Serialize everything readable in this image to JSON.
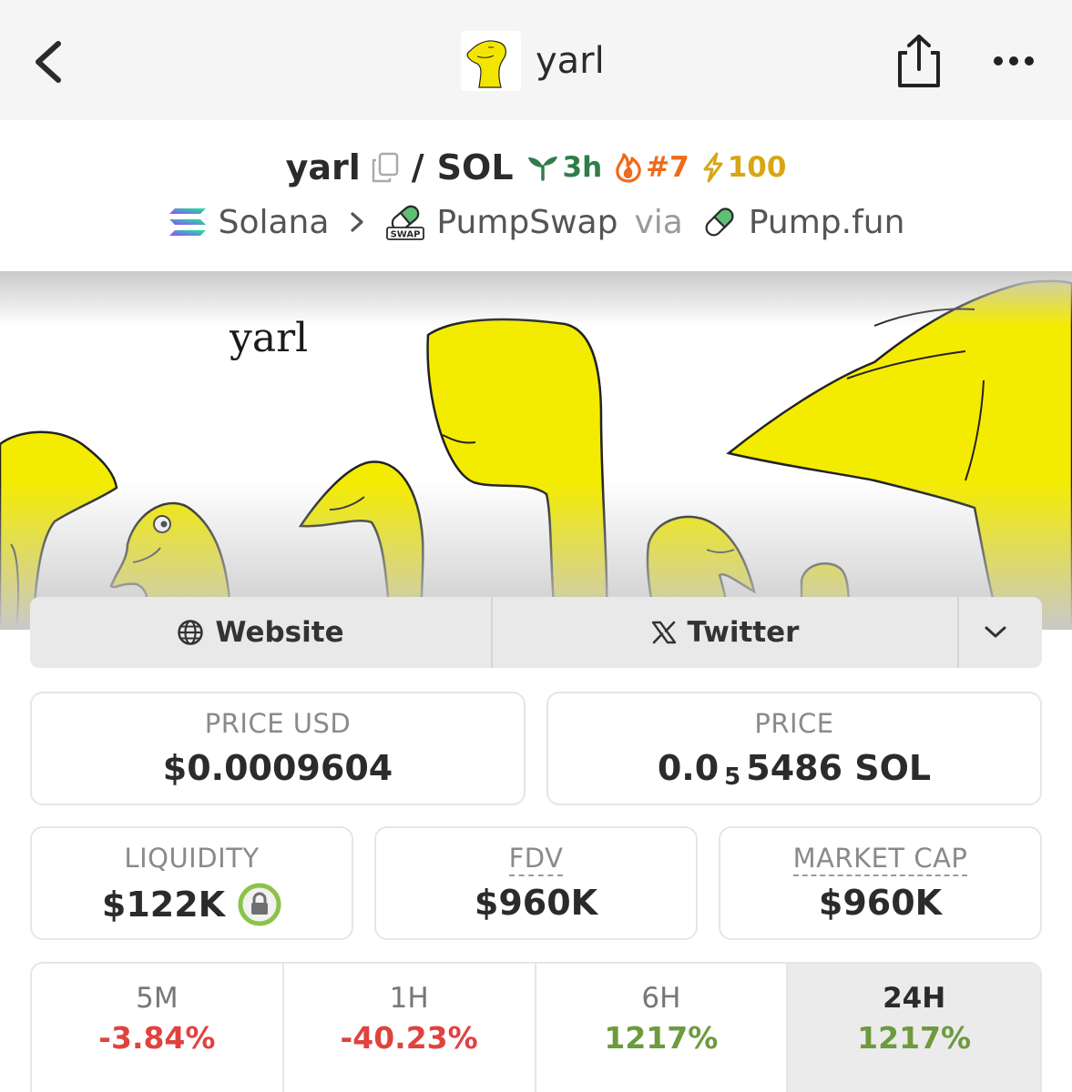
{
  "header": {
    "title": "yarl"
  },
  "pair": {
    "base": "yarl",
    "separator": "/",
    "quote": "SOL",
    "age": "3h",
    "rank": "#7",
    "boost": "100",
    "colors": {
      "age": "#2f7d4a",
      "rank": "#ef6a1a",
      "boost": "#d7a614"
    }
  },
  "chain": {
    "network": "Solana",
    "dex": "PumpSwap",
    "via_label": "via",
    "launchpad": "Pump.fun",
    "dex_icon_text": "SWAP"
  },
  "banner": {
    "caption": "yarl"
  },
  "links": {
    "website": "Website",
    "twitter": "Twitter"
  },
  "stats": {
    "price_usd_label": "PRICE USD",
    "price_usd": "$0.0009604",
    "price_label": "PRICE",
    "price_prefix": "0.0",
    "price_zeros": "5",
    "price_suffix": "5486 SOL",
    "liquidity_label": "LIQUIDITY",
    "liquidity": "$122K",
    "fdv_label": "FDV",
    "fdv": "$960K",
    "mcap_label": "MARKET CAP",
    "mcap": "$960K"
  },
  "changes": [
    {
      "label": "5M",
      "value": "-3.84%"
    },
    {
      "label": "1H",
      "value": "-40.23%"
    },
    {
      "label": "6H",
      "value": "1217%"
    },
    {
      "label": "24H",
      "value": "1217%"
    }
  ],
  "colors": {
    "negative": "#e0423f",
    "positive": "#6e9a3f",
    "lock_ring": "#8bc34a"
  }
}
